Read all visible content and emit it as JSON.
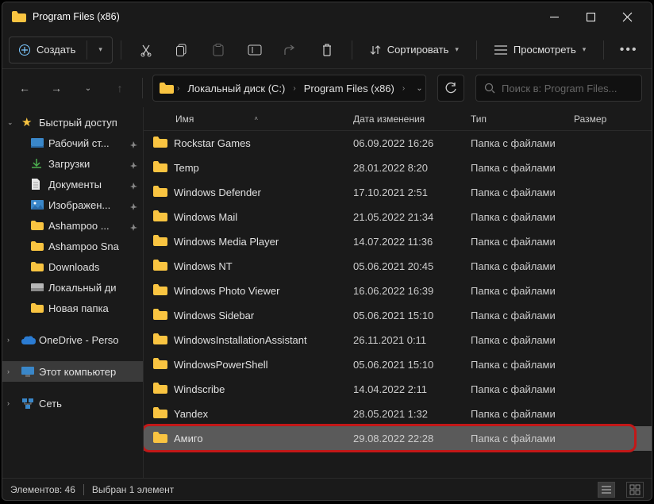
{
  "title": "Program Files (x86)",
  "toolbar": {
    "create": "Создать",
    "sort": "Сортировать",
    "view": "Просмотреть"
  },
  "breadcrumbs": [
    "Локальный диск (C:)",
    "Program Files (x86)"
  ],
  "search_placeholder": "Поиск в: Program Files...",
  "sidebar": {
    "quick": "Быстрый доступ",
    "desktop": "Рабочий ст...",
    "downloads": "Загрузки",
    "documents": "Документы",
    "pictures": "Изображен...",
    "ashampoo": "Ashampoo ...",
    "ashampooSnap": "Ashampoo Sna",
    "downloadsEn": "Downloads",
    "localdisk": "Локальный ди",
    "newfolder": "Новая папка",
    "onedrive": "OneDrive - Perso",
    "thispc": "Этот компьютер",
    "network": "Сеть"
  },
  "columns": {
    "name": "Имя",
    "date": "Дата изменения",
    "type": "Тип",
    "size": "Размер"
  },
  "folderType": "Папка с файлами",
  "rows": [
    {
      "name": "Rockstar Games",
      "date": "06.09.2022 16:26"
    },
    {
      "name": "Temp",
      "date": "28.01.2022 8:20"
    },
    {
      "name": "Windows Defender",
      "date": "17.10.2021 2:51"
    },
    {
      "name": "Windows Mail",
      "date": "21.05.2022 21:34"
    },
    {
      "name": "Windows Media Player",
      "date": "14.07.2022 11:36"
    },
    {
      "name": "Windows NT",
      "date": "05.06.2021 20:45"
    },
    {
      "name": "Windows Photo Viewer",
      "date": "16.06.2022 16:39"
    },
    {
      "name": "Windows Sidebar",
      "date": "05.06.2021 15:10"
    },
    {
      "name": "WindowsInstallationAssistant",
      "date": "26.11.2021 0:11"
    },
    {
      "name": "WindowsPowerShell",
      "date": "05.06.2021 15:10"
    },
    {
      "name": "Windscribe",
      "date": "14.04.2022 2:11"
    },
    {
      "name": "Yandex",
      "date": "28.05.2021 1:32"
    },
    {
      "name": "Амиго",
      "date": "29.08.2022 22:28",
      "selected": true
    }
  ],
  "status": {
    "count": "Элементов: 46",
    "selected": "Выбран 1 элемент"
  }
}
